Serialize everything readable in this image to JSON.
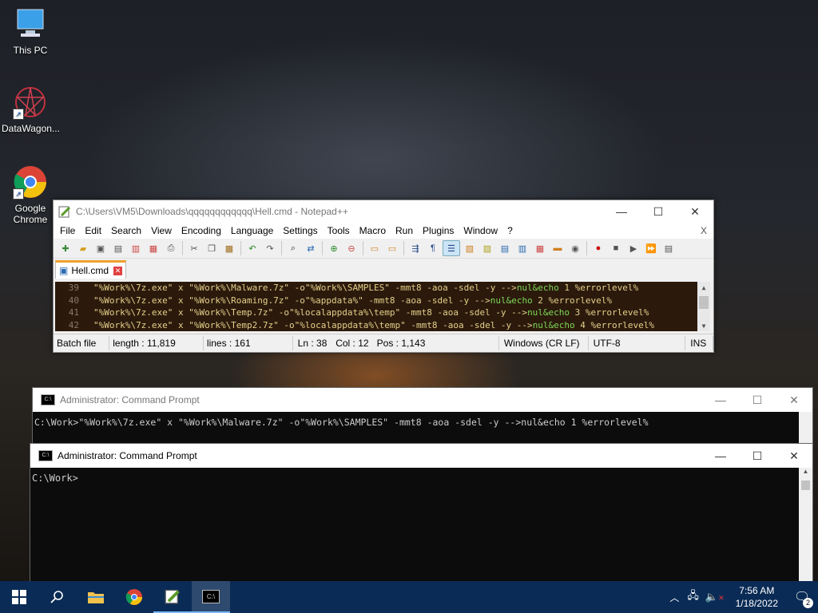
{
  "desktop": {
    "icons": [
      {
        "label": "This PC",
        "icon": "computer-icon"
      },
      {
        "label": "DataWagon...",
        "icon": "datawagon-app-icon"
      },
      {
        "label": "Google Chrome",
        "icon": "chrome-icon"
      }
    ]
  },
  "notepad": {
    "title": "C:\\Users\\VM5\\Downloads\\qqqqqqqqqqqq\\Hell.cmd - Notepad++",
    "menu": [
      "File",
      "Edit",
      "Search",
      "View",
      "Encoding",
      "Language",
      "Settings",
      "Tools",
      "Macro",
      "Run",
      "Plugins",
      "Window",
      "?"
    ],
    "menu_close": "X",
    "tab": "Hell.cmd",
    "lines": [
      {
        "num": "39",
        "code": "\"%Work%\\7z.exe\" x \"%Work%\\Malware.7z\" -o\"%Work%\\SAMPLES\" -mmt8 -aoa -sdel -y -->",
        "tail1": "nul&echo",
        "tail2": " 1 %errorlevel%"
      },
      {
        "num": "40",
        "code": "\"%Work%\\7z.exe\" x \"%Work%\\Roaming.7z\" -o\"%appdata%\" -mmt8 -aoa -sdel -y -->",
        "tail1": "nul&echo",
        "tail2": " 2 %errorlevel%"
      },
      {
        "num": "41",
        "code": "\"%Work%\\7z.exe\" x \"%Work%\\Temp.7z\" -o\"%localappdata%\\temp\" -mmt8 -aoa -sdel -y -->",
        "tail1": "nul&echo",
        "tail2": " 3 %errorlevel%"
      },
      {
        "num": "42",
        "code": "\"%Work%\\7z.exe\" x \"%Work%\\Temp2.7z\" -o\"%localappdata%\\temp\" -mmt8 -aoa -sdel -y -->",
        "tail1": "nul&echo",
        "tail2": " 4 %errorlevel%"
      }
    ],
    "status": {
      "type": "Batch file",
      "length": "length : 11,819",
      "lines": "lines : 161",
      "ln": "Ln : 38",
      "col": "Col : 12",
      "pos": "Pos : 1,143",
      "eol": "Windows (CR LF)",
      "encoding": "UTF-8",
      "mode": "INS"
    }
  },
  "cmd1": {
    "title": "Administrator: Command Prompt",
    "text": "C:\\Work>\"%Work%\\7z.exe\" x \"%Work%\\Malware.7z\" -o\"%Work%\\SAMPLES\" -mmt8 -aoa -sdel -y -->nul&echo 1 %errorlevel%"
  },
  "cmd2": {
    "title": "Administrator: Command Prompt",
    "text": "C:\\Work>"
  },
  "taskbar": {
    "time": "7:56 AM",
    "date": "1/18/2022",
    "notifications": "2"
  }
}
